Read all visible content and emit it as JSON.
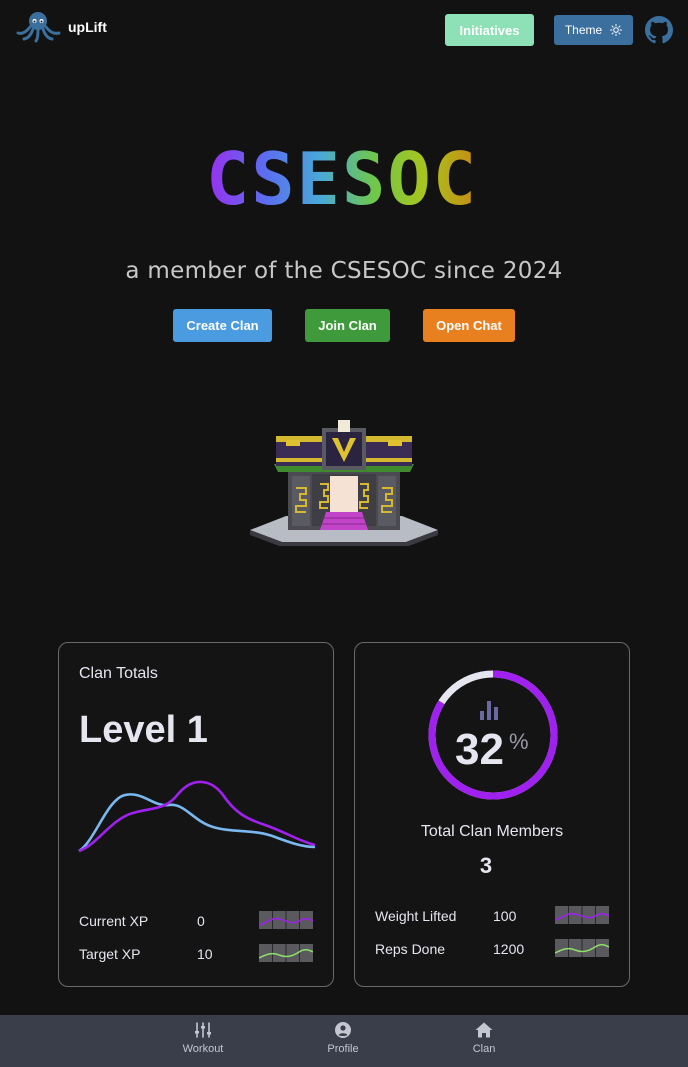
{
  "header": {
    "app_name": "upLift",
    "initiatives_label": "Initiatives",
    "theme_label": "Theme"
  },
  "hero": {
    "title": "CSESOC",
    "subtitle": "a member of the CSESOC since 2024",
    "actions": {
      "create": "Create Clan",
      "join": "Join Clan",
      "chat": "Open Chat"
    }
  },
  "clan_totals": {
    "label": "Clan Totals",
    "level": "Level 1",
    "stats": [
      {
        "label": "Current XP",
        "value": "0"
      },
      {
        "label": "Target XP",
        "value": "10"
      }
    ]
  },
  "clan_members": {
    "percent": "32",
    "percent_symbol": "%",
    "percent_value": 32,
    "label": "Total Clan Members",
    "count": "3",
    "stats": [
      {
        "label": "Weight Lifted",
        "value": "100"
      },
      {
        "label": "Reps Done",
        "value": "1200"
      }
    ]
  },
  "nav": {
    "items": [
      {
        "label": "Workout",
        "icon": "sliders-icon"
      },
      {
        "label": "Profile",
        "icon": "user-circle-icon"
      },
      {
        "label": "Clan",
        "icon": "home-icon"
      }
    ]
  },
  "colors": {
    "background": "#121212",
    "initiatives": "#8ee0b6",
    "theme": "#3a6f9e",
    "create": "#4a9be0",
    "join": "#3f9a3b",
    "chat": "#e8801f",
    "purple": "#a020f0",
    "blue": "#7ab8f0",
    "nav": "#3a3d4a"
  }
}
